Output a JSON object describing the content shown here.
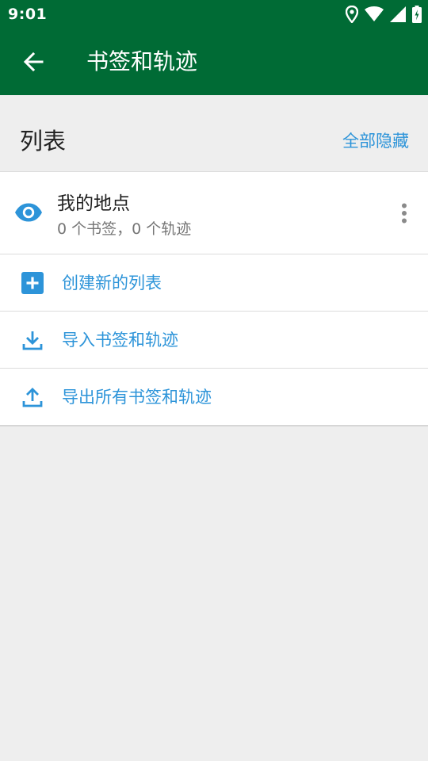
{
  "status_bar": {
    "time": "9:01",
    "icons": [
      "location-icon",
      "wifi-icon",
      "signal-icon",
      "battery-icon"
    ]
  },
  "app_bar": {
    "title": "书签和轨迹",
    "back_icon": "arrow-back-icon"
  },
  "section": {
    "title": "列表",
    "hide_all_label": "全部隐藏"
  },
  "lists": [
    {
      "name": "我的地点",
      "summary": "0 个书签，0 个轨迹",
      "visible_icon": "eye-icon",
      "menu_icon": "more-vert-icon"
    }
  ],
  "actions": [
    {
      "label": "创建新的列表",
      "icon": "add-box-icon"
    },
    {
      "label": "导入书签和轨迹",
      "icon": "download-icon"
    },
    {
      "label": "导出所有书签和轨迹",
      "icon": "upload-icon"
    }
  ],
  "colors": {
    "header_green": "#006b35",
    "accent_blue": "#2d94d9",
    "background": "#eeeeee",
    "card": "#ffffff",
    "primary_text": "#212121",
    "secondary_text": "#757575"
  }
}
